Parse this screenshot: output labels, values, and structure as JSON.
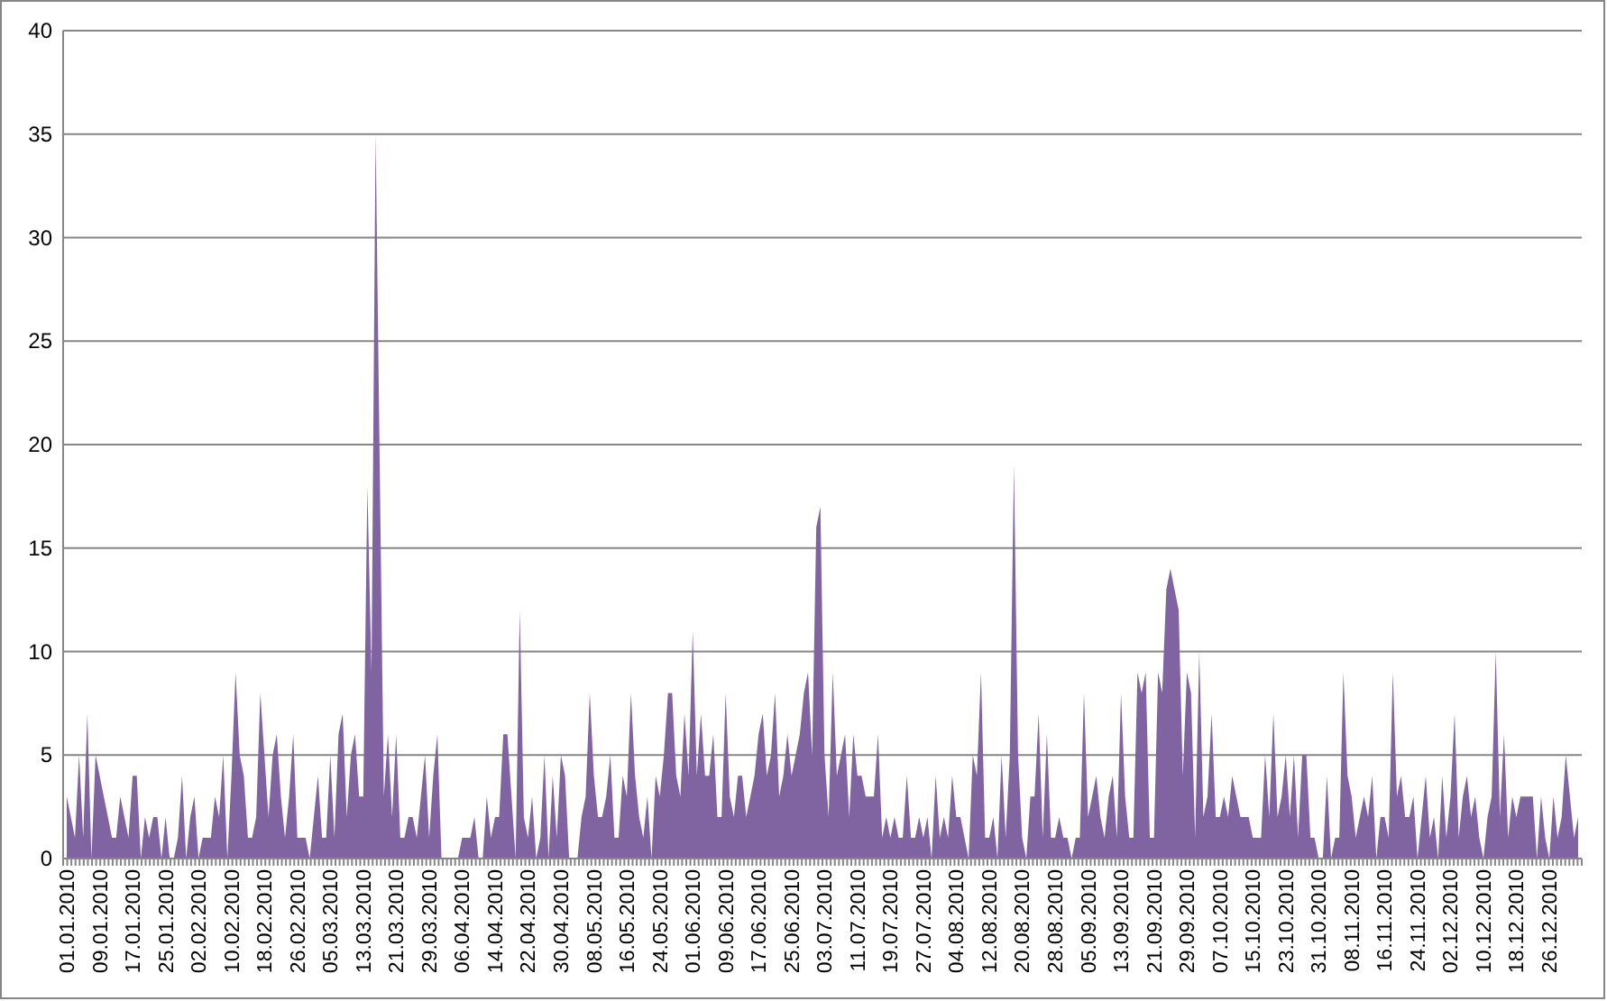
{
  "chart_data": {
    "type": "area",
    "grid": true,
    "ylim": [
      0,
      40
    ],
    "yticks": [
      0,
      5,
      10,
      15,
      20,
      25,
      30,
      35,
      40
    ],
    "categories": [
      "01.01.2010",
      null,
      null,
      null,
      null,
      null,
      null,
      null,
      "09.01.2010",
      null,
      null,
      null,
      null,
      null,
      null,
      null,
      "17.01.2010",
      null,
      null,
      null,
      null,
      null,
      null,
      null,
      "25.01.2010",
      null,
      null,
      null,
      null,
      null,
      null,
      null,
      "02.02.2010",
      null,
      null,
      null,
      null,
      null,
      null,
      null,
      "10.02.2010",
      null,
      null,
      null,
      null,
      null,
      null,
      null,
      "18.02.2010",
      null,
      null,
      null,
      null,
      null,
      null,
      null,
      "26.02.2010",
      null,
      null,
      null,
      null,
      null,
      null,
      null,
      "05.03.2010",
      null,
      null,
      null,
      null,
      null,
      null,
      null,
      "13.03.2010",
      null,
      null,
      null,
      null,
      null,
      null,
      null,
      "21.03.2010",
      null,
      null,
      null,
      null,
      null,
      null,
      null,
      "29.03.2010",
      null,
      null,
      null,
      null,
      null,
      null,
      null,
      "06.04.2010",
      null,
      null,
      null,
      null,
      null,
      null,
      null,
      "14.04.2010",
      null,
      null,
      null,
      null,
      null,
      null,
      null,
      "22.04.2010",
      null,
      null,
      null,
      null,
      null,
      null,
      null,
      "30.04.2010",
      null,
      null,
      null,
      null,
      null,
      null,
      null,
      "08.05.2010",
      null,
      null,
      null,
      null,
      null,
      null,
      null,
      "16.05.2010",
      null,
      null,
      null,
      null,
      null,
      null,
      null,
      "24.05.2010",
      null,
      null,
      null,
      null,
      null,
      null,
      null,
      "01.06.2010",
      null,
      null,
      null,
      null,
      null,
      null,
      null,
      "09.06.2010",
      null,
      null,
      null,
      null,
      null,
      null,
      null,
      "17.06.2010",
      null,
      null,
      null,
      null,
      null,
      null,
      null,
      "25.06.2010",
      null,
      null,
      null,
      null,
      null,
      null,
      null,
      "03.07.2010",
      null,
      null,
      null,
      null,
      null,
      null,
      null,
      "11.07.2010",
      null,
      null,
      null,
      null,
      null,
      null,
      null,
      "19.07.2010",
      null,
      null,
      null,
      null,
      null,
      null,
      null,
      "27.07.2010",
      null,
      null,
      null,
      null,
      null,
      null,
      null,
      "04.08.2010",
      null,
      null,
      null,
      null,
      null,
      null,
      null,
      "12.08.2010",
      null,
      null,
      null,
      null,
      null,
      null,
      null,
      "20.08.2010",
      null,
      null,
      null,
      null,
      null,
      null,
      null,
      "28.08.2010",
      null,
      null,
      null,
      null,
      null,
      null,
      null,
      "05.09.2010",
      null,
      null,
      null,
      null,
      null,
      null,
      null,
      "13.09.2010",
      null,
      null,
      null,
      null,
      null,
      null,
      null,
      "21.09.2010",
      null,
      null,
      null,
      null,
      null,
      null,
      null,
      "29.09.2010",
      null,
      null,
      null,
      null,
      null,
      null,
      null,
      "07.10.2010",
      null,
      null,
      null,
      null,
      null,
      null,
      null,
      "15.10.2010",
      null,
      null,
      null,
      null,
      null,
      null,
      null,
      "23.10.2010",
      null,
      null,
      null,
      null,
      null,
      null,
      null,
      "31.10.2010",
      null,
      null,
      null,
      null,
      null,
      null,
      null,
      "08.11.2010",
      null,
      null,
      null,
      null,
      null,
      null,
      null,
      "16.11.2010",
      null,
      null,
      null,
      null,
      null,
      null,
      null,
      "24.11.2010",
      null,
      null,
      null,
      null,
      null,
      null,
      null,
      "02.12.2010",
      null,
      null,
      null,
      null,
      null,
      null,
      null,
      "10.12.2010",
      null,
      null,
      null,
      null,
      null,
      null,
      null,
      "18.12.2010",
      null,
      null,
      null,
      null,
      null,
      null,
      null,
      "26.12.2010",
      null,
      null,
      null,
      null,
      null,
      null,
      null
    ],
    "series": [
      {
        "color": "#8064a2",
        "values": [
          3,
          2,
          1,
          5,
          1,
          7,
          0,
          5,
          4,
          3,
          2,
          1,
          1,
          3,
          2,
          1,
          4,
          4,
          0,
          2,
          1,
          2,
          2,
          0,
          2,
          0,
          0,
          1,
          4,
          0,
          2,
          3,
          0,
          1,
          1,
          1,
          3,
          2,
          5,
          0,
          4,
          9,
          5,
          4,
          1,
          1,
          2,
          8,
          5,
          2,
          5,
          6,
          3,
          1,
          3,
          6,
          1,
          1,
          1,
          0,
          2,
          4,
          1,
          1,
          5,
          1,
          6,
          7,
          2,
          5,
          6,
          3,
          3,
          18,
          9,
          35,
          19,
          3,
          6,
          2,
          6,
          1,
          1,
          2,
          2,
          1,
          3,
          5,
          1,
          4,
          6,
          0,
          0,
          0,
          0,
          0,
          1,
          1,
          1,
          2,
          0,
          0,
          3,
          1,
          2,
          2,
          6,
          6,
          3,
          0,
          12,
          2,
          1,
          3,
          0,
          1,
          5,
          0,
          4,
          1,
          5,
          4,
          0,
          0,
          0,
          2,
          3,
          8,
          4,
          2,
          2,
          3,
          5,
          1,
          1,
          4,
          3,
          8,
          4,
          2,
          1,
          3,
          0,
          4,
          3,
          5,
          8,
          8,
          4,
          3,
          7,
          4,
          11,
          4,
          7,
          4,
          4,
          6,
          2,
          2,
          8,
          3,
          2,
          4,
          4,
          2,
          3,
          4,
          6,
          7,
          4,
          5,
          8,
          3,
          4,
          6,
          4,
          5,
          6,
          8,
          9,
          5,
          16,
          17,
          5,
          2,
          9,
          4,
          5,
          6,
          2,
          6,
          4,
          4,
          3,
          3,
          3,
          6,
          1,
          2,
          1,
          2,
          1,
          1,
          4,
          1,
          1,
          2,
          1,
          2,
          0,
          4,
          1,
          2,
          1,
          4,
          2,
          2,
          1,
          0,
          5,
          4,
          9,
          1,
          1,
          2,
          0,
          5,
          1,
          5,
          19,
          5,
          1,
          0,
          3,
          3,
          7,
          1,
          6,
          1,
          1,
          2,
          1,
          1,
          0,
          1,
          1,
          8,
          2,
          3,
          4,
          2,
          1,
          3,
          4,
          1,
          8,
          3,
          1,
          1,
          9,
          8,
          9,
          1,
          1,
          9,
          8,
          13,
          14,
          13,
          12,
          4,
          9,
          8,
          1,
          10,
          2,
          3,
          7,
          2,
          2,
          3,
          2,
          4,
          3,
          2,
          2,
          2,
          1,
          1,
          1,
          5,
          2,
          7,
          2,
          3,
          5,
          2,
          5,
          1,
          5,
          5,
          1,
          1,
          0,
          0,
          4,
          0,
          1,
          1,
          9,
          4,
          3,
          1,
          2,
          3,
          2,
          4,
          0,
          2,
          2,
          1,
          9,
          3,
          4,
          2,
          2,
          3,
          0,
          2,
          4,
          1,
          2,
          0,
          4,
          1,
          3,
          7,
          1,
          3,
          4,
          2,
          3,
          1,
          0,
          2,
          3,
          10,
          2,
          6,
          1,
          3,
          2,
          3,
          3,
          3,
          3,
          0,
          3,
          1,
          0,
          3,
          1,
          2,
          5,
          3,
          1,
          2
        ]
      }
    ]
  }
}
